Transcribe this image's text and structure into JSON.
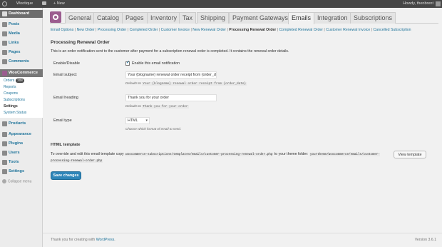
{
  "admin_bar": {
    "site_name": "Wootique",
    "new_label": "+ New",
    "howdy": "Howdy, thenbrent"
  },
  "sidebar": {
    "items": [
      {
        "label": "Dashboard"
      },
      {
        "label": "Posts"
      },
      {
        "label": "Media"
      },
      {
        "label": "Links"
      },
      {
        "label": "Pages"
      },
      {
        "label": "Comments"
      },
      {
        "label": "WooCommerce"
      },
      {
        "label": "Products"
      },
      {
        "label": "Appearance"
      },
      {
        "label": "Plugins"
      },
      {
        "label": "Users"
      },
      {
        "label": "Tools"
      },
      {
        "label": "Settings"
      }
    ],
    "woo_submenu": [
      {
        "label": "Orders",
        "badge": "208"
      },
      {
        "label": "Reports"
      },
      {
        "label": "Coupons"
      },
      {
        "label": "Subscriptions"
      },
      {
        "label": "Settings"
      },
      {
        "label": "System Status"
      }
    ],
    "collapse_label": "Collapse menu"
  },
  "tabs": [
    {
      "label": "General"
    },
    {
      "label": "Catalog"
    },
    {
      "label": "Pages"
    },
    {
      "label": "Inventory"
    },
    {
      "label": "Tax"
    },
    {
      "label": "Shipping"
    },
    {
      "label": "Payment Gateways"
    },
    {
      "label": "Emails"
    },
    {
      "label": "Integration"
    },
    {
      "label": "Subscriptions"
    }
  ],
  "sublinks": [
    "Email Options",
    "New Order",
    "Processing Order",
    "Completed Order",
    "Customer Invoice",
    "New Renewal Order",
    "Processing Renewal Order",
    "Completed Renewal Order",
    "Customer Renewal Invoice",
    "Cancelled Subscription"
  ],
  "section": {
    "title": "Processing Renewal Order",
    "description": "This is an order notification sent to the customer after payment for a subscription renewal order is completed. It contains the renewal order details."
  },
  "form": {
    "enable_label": "Enable/Disable",
    "enable_checkbox_label": "Enable this email notification",
    "enable_checked": true,
    "subject_label": "Email subject",
    "subject_value": "Your {blogname} renewal order receipt from {order_d",
    "subject_hint_prefix": "Defaults to",
    "subject_default": "Your {blogname} renewal order receipt from {order_date}",
    "heading_label": "Email heading",
    "heading_value": "Thank you for your order",
    "heading_hint_prefix": "Defaults to",
    "heading_default": "Thank you for your order",
    "type_label": "Email type",
    "type_value": "HTML",
    "type_hint": "Choose which format of email to send."
  },
  "template": {
    "title": "HTML template",
    "text_prefix": "To override and edit this email template copy",
    "source_path": "woocommerce-subscriptions/templates/emails/customer-processing-renewal-order.php",
    "text_middle": "to your theme folder:",
    "dest_path": "yourtheme/woocommerce/emails/customer-processing-renewal-order.php",
    "view_button": "View template"
  },
  "save_button": "Save changes",
  "footer": {
    "thanks_prefix": "Thank you for creating with",
    "wp_link": "WordPress",
    "thanks_suffix": ".",
    "version": "Version 3.6.1"
  },
  "colors": {
    "admin_bar": "#464646",
    "link": "#21759b",
    "woo_purple": "#9b5c8f",
    "primary_button": "#2e85b8"
  }
}
